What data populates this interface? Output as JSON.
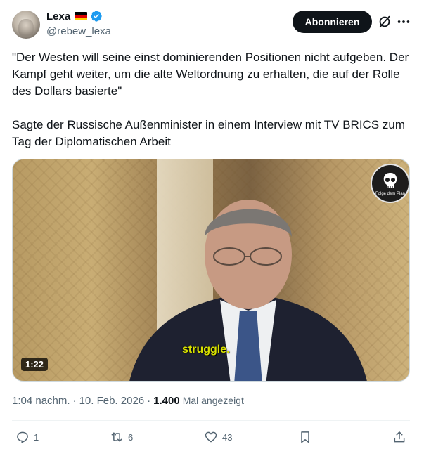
{
  "author": {
    "name": "Lexa",
    "handle": "@rebew_lexa",
    "flag_icon": "germany-flag-icon",
    "verified_icon": "verified-badge-icon",
    "verified_color": "#1d9bf0"
  },
  "header": {
    "subscribe_label": "Abonnieren",
    "grok_icon": "grok-icon",
    "more_icon": "more-icon"
  },
  "post": {
    "text": "\"Der Westen will seine einst dominierenden Positionen nicht aufgeben. Der Kampf geht weiter, um die alte Weltordnung zu erhalten, die auf der Rolle des Dollars basierte\"\n\nSagte der Russische Außenminister in einem Interview mit TV BRICS zum Tag der Diplomatischen Arbeit"
  },
  "media": {
    "subtitle": "struggle.",
    "duration": "1:22",
    "watermark_text": "Folge dem Plan"
  },
  "meta": {
    "time": "1:04 nachm.",
    "separator1": "·",
    "date": "10. Feb. 2026",
    "separator2": "·",
    "views": "1.400",
    "views_label": "Mal angezeigt"
  },
  "actions": {
    "replies": "1",
    "reposts": "6",
    "likes": "43"
  },
  "colors": {
    "text": "#0f1419",
    "secondary": "#536471",
    "accent": "#1d9bf0",
    "subtitle": "#d8e100"
  }
}
